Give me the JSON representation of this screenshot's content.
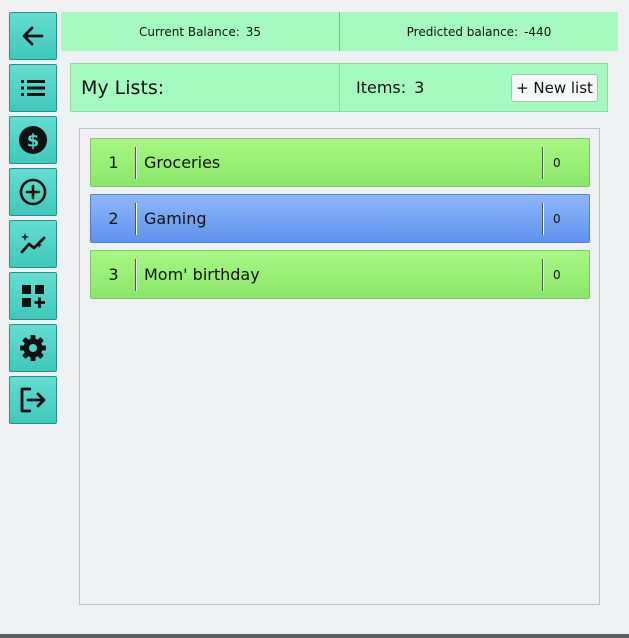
{
  "sidebar": {
    "items": [
      {
        "icon": "arrow-left-icon"
      },
      {
        "icon": "list-icon"
      },
      {
        "icon": "dollar-coin-icon"
      },
      {
        "icon": "plus-circle-icon"
      },
      {
        "icon": "trend-sparkle-icon"
      },
      {
        "icon": "add-widget-icon"
      },
      {
        "icon": "gear-icon"
      },
      {
        "icon": "logout-icon"
      }
    ]
  },
  "balance": {
    "current_label": "Current Balance:",
    "current_value": "35",
    "predicted_label": "Predicted balance:",
    "predicted_value": "-440"
  },
  "header": {
    "title": "My Lists:",
    "items_label": "Items:",
    "items_count": "3",
    "new_list_label": "+ New list"
  },
  "lists": [
    {
      "number": "1",
      "name": "Groceries",
      "count": "0",
      "selected": false
    },
    {
      "number": "2",
      "name": "Gaming",
      "count": "0",
      "selected": true
    },
    {
      "number": "3",
      "name": "Mom' birthday",
      "count": "0",
      "selected": false
    }
  ],
  "colors": {
    "accent_teal": "#4fd4c6",
    "header_green": "#a5fbbf",
    "row_green": "#9af07a",
    "row_selected_blue": "#6f9ff0"
  }
}
